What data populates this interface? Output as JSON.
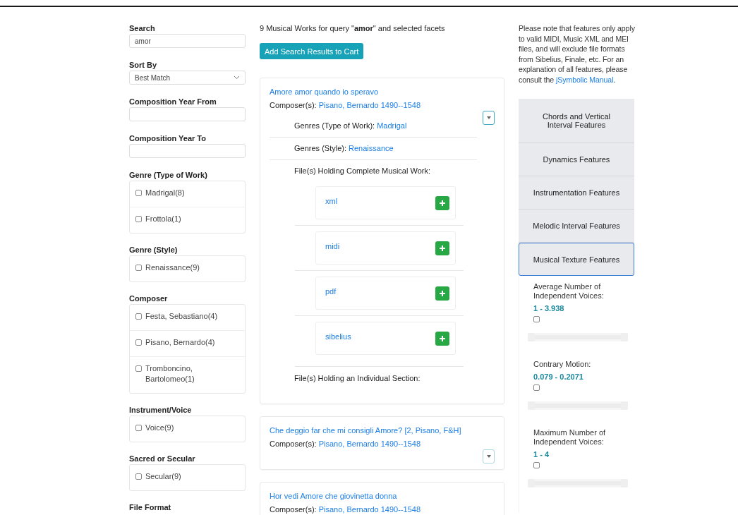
{
  "sidebar": {
    "fields": [
      {
        "kind": "text",
        "label": "Search",
        "value": "amor"
      },
      {
        "kind": "select",
        "label": "Sort By",
        "value": "Best Match"
      },
      {
        "kind": "text",
        "label": "Composition Year From"
      },
      {
        "kind": "text",
        "label": "Composition Year To"
      },
      {
        "kind": "facet",
        "label": "Genre (Type of Work)",
        "options": [
          {
            "label": "Madrigal(8)",
            "checked": false
          },
          {
            "label": "Frottola(1)",
            "checked": false
          }
        ]
      },
      {
        "kind": "facet",
        "label": "Genre (Style)",
        "options": [
          {
            "label": "Renaissance(9)",
            "checked": false
          }
        ]
      },
      {
        "kind": "facet",
        "label": "Composer",
        "options": [
          {
            "label": "Festa, Sebastiano(4)",
            "checked": false
          },
          {
            "label": "Pisano, Bernardo(4)",
            "checked": false
          },
          {
            "label": "Tromboncino, Bartolomeo(1)",
            "checked": false
          }
        ]
      },
      {
        "kind": "facet",
        "label": "Instrument/Voice",
        "options": [
          {
            "label": "Voice(9)",
            "checked": false
          }
        ]
      },
      {
        "kind": "facet",
        "label": "Sacred or Secular",
        "options": [
          {
            "label": "Secular(9)",
            "checked": false
          }
        ]
      },
      {
        "kind": "facet",
        "label": "File Format"
      }
    ]
  },
  "results": {
    "summary": "9 Musical Works for query \"**amor**\" and selected facets",
    "add_button": "Add Search Results to Cart",
    "works": [
      {
        "title": "Amore amor quando io speravo",
        "composer_label": "Composer(s):",
        "composer": "Pisano, Bernardo 1490--1548",
        "expanded": true,
        "details": [
          {
            "label": "Genres (Type of Work):",
            "value": "Madrigal"
          },
          {
            "label": "Genres (Style):",
            "value": "Renaissance"
          }
        ],
        "complete_files_label": "File(s) Holding Complete Musical Work:",
        "files": [
          "xml",
          "midi",
          "pdf",
          "sibelius"
        ],
        "section_files_label": "File(s) Holding an Individual Section:"
      },
      {
        "title": "Che deggio far che mi consigli Amore? [2, Pisano, F&H]",
        "composer_label": "Composer(s):",
        "composer": "Pisano, Bernardo 1490--1548",
        "expanded": false
      },
      {
        "title": "Hor vedi Amore che giovinetta donna",
        "composer_label": "Composer(s):",
        "composer": "Pisano, Bernardo 1490--1548"
      }
    ]
  },
  "features": {
    "note": "Please note that features only apply to valid MIDI, Music XML and MEI files, and will exclude file formats from Sibelius, Finale, etc. For an explanation of all features, please consult the",
    "note_link": "jSymbolic Manual",
    "note_end": ".",
    "groups": [
      {
        "label": "Chords and Vertical Interval Features",
        "expanded": false
      },
      {
        "label": "Dynamics Features",
        "expanded": false
      },
      {
        "label": "Instrumentation Features",
        "expanded": false
      },
      {
        "label": "Melodic Interval Features",
        "expanded": false
      },
      {
        "label": "Musical Texture Features",
        "expanded": true
      }
    ],
    "ranges": [
      {
        "label": "Average Number of Independent Voices:",
        "range": "1 - 3.938",
        "checked": false,
        "level": 1
      },
      {
        "label": "Contrary Motion:",
        "range": "0.079 - 0.2071",
        "checked": false,
        "level": 1
      },
      {
        "label": "Maximum Number of Independent Voices:",
        "range": "1 - 4",
        "checked": false,
        "level": 1
      }
    ]
  }
}
